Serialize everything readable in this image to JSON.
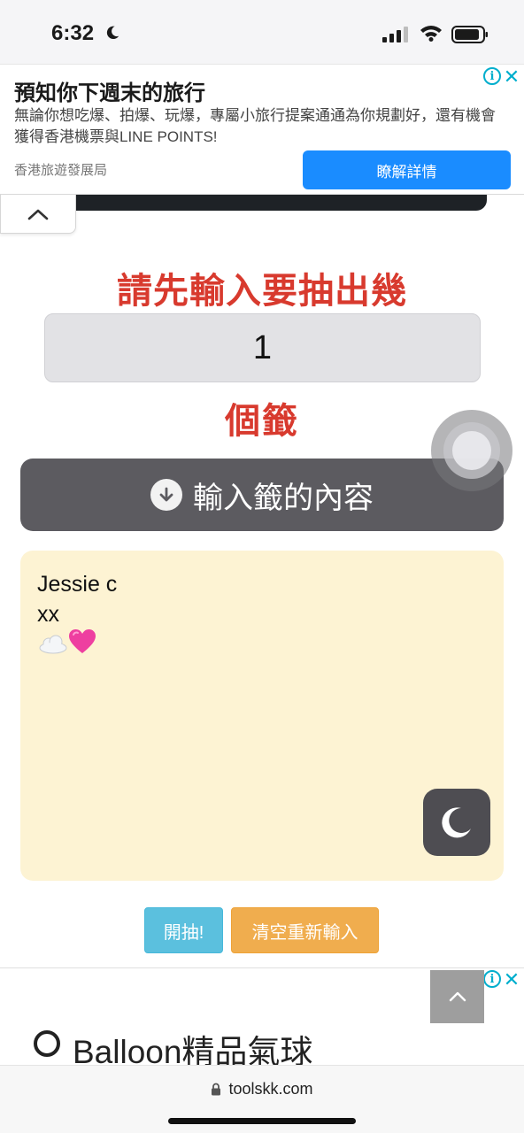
{
  "status_bar": {
    "time": "6:32"
  },
  "ad_top": {
    "title": "預知你下週末的旅行",
    "description": "無論你想吃爆、拍爆、玩爆，專屬小旅行提案通通為你規劃好，還有機會獲得香港機票與LINE POINTS!",
    "advertiser": "香港旅遊發展局",
    "cta_label": "瞭解詳情",
    "info_glyph": "i",
    "close_glyph": "✕"
  },
  "main": {
    "heading_top": "請先輸入要抽出幾",
    "count_value": "1",
    "heading_bottom": "個籤",
    "content_button_label": "輸入籤的內容",
    "lots_lines": [
      "Jessie c",
      "xx"
    ],
    "emoji_line": [
      "cloud",
      "pink-heart"
    ]
  },
  "actions": {
    "draw_label": "開抽!",
    "clear_label": "清空重新輸入"
  },
  "ad_bottom": {
    "title": "Balloon精品氣球",
    "info_glyph": "i",
    "close_glyph": "✕"
  },
  "browser": {
    "url": "toolskk.com"
  },
  "colors": {
    "heading_red": "#d83a2e",
    "cta_blue": "#1a8cff",
    "draw_button": "#5bc0de",
    "clear_button": "#f0ad4e",
    "textarea_bg": "#fdf3d3",
    "content_button_bg": "#5c5b60"
  },
  "icons": [
    "moon-icon",
    "cellular-signal-icon",
    "wifi-icon",
    "battery-icon",
    "ad-info-icon",
    "ad-close-icon",
    "chevron-up-icon",
    "arrow-down-circle-icon",
    "moon-icon",
    "lock-icon"
  ]
}
